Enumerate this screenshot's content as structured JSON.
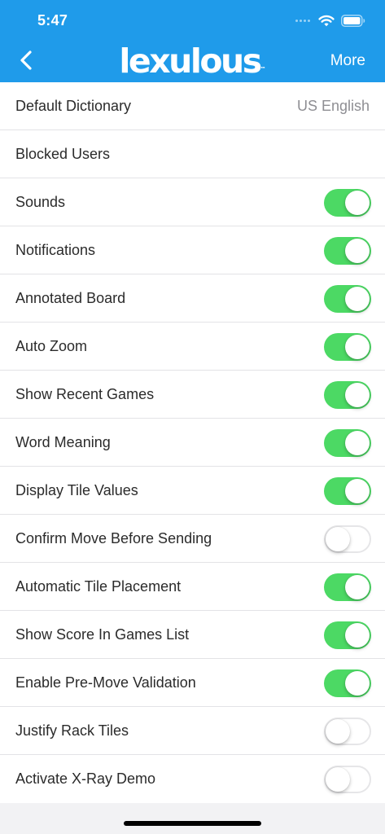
{
  "status_bar": {
    "time": "5:47"
  },
  "header": {
    "logo": "lexulous",
    "logo_tm": "™",
    "more_label": "More",
    "background_color": "#1f9bea"
  },
  "settings": {
    "default_dictionary": {
      "label": "Default Dictionary",
      "value": "US English"
    },
    "blocked_users": {
      "label": "Blocked Users"
    },
    "toggles": [
      {
        "label": "Sounds",
        "on": true
      },
      {
        "label": "Notifications",
        "on": true
      },
      {
        "label": "Annotated Board",
        "on": true
      },
      {
        "label": "Auto Zoom",
        "on": true
      },
      {
        "label": "Show Recent Games",
        "on": true
      },
      {
        "label": "Word Meaning",
        "on": true
      },
      {
        "label": "Display Tile Values",
        "on": true
      },
      {
        "label": "Confirm Move Before Sending",
        "on": false
      },
      {
        "label": "Automatic Tile Placement",
        "on": true
      },
      {
        "label": "Show Score In Games List",
        "on": true
      },
      {
        "label": "Enable Pre-Move Validation",
        "on": true
      },
      {
        "label": "Justify Rack Tiles",
        "on": false
      },
      {
        "label": "Activate X-Ray Demo",
        "on": false
      }
    ]
  },
  "colors": {
    "toggle_on": "#4cd964",
    "toggle_off_border": "#e6e6e8",
    "background": "#f2f2f4"
  }
}
